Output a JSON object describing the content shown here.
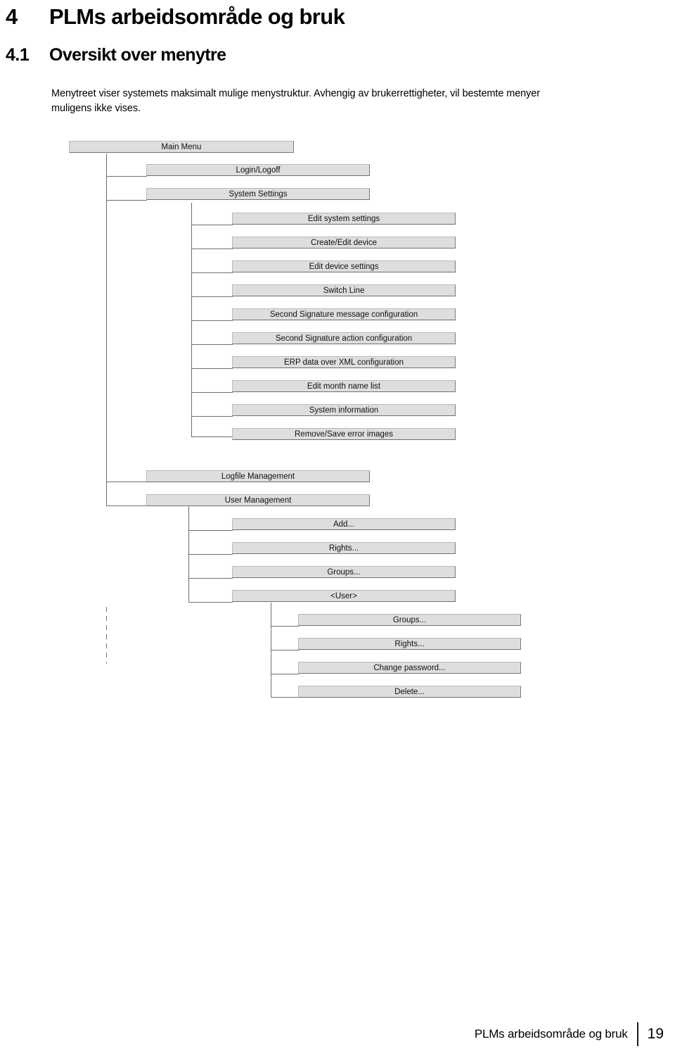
{
  "document": {
    "chapter_number": "4",
    "chapter_title": "PLMs arbeidsområde og bruk",
    "section_number": "4.1",
    "section_title": "Oversikt over menytre",
    "intro_paragraph": "Menytreet viser systemets maksimalt mulige menystruktur. Avhengig av brukerrettigheter, vil bestemte menyer muligens ikke vises."
  },
  "footer": {
    "title": "PLMs arbeidsområde og bruk",
    "page_number": "19"
  },
  "colors": {
    "node_fill": "#dedede",
    "node_border_dark": "#6f6f6f",
    "line": "#6f6f6f",
    "text": "#111111"
  },
  "menu_tree": {
    "root": "Main Menu",
    "nodes": [
      {
        "id": "main-menu",
        "label": "Main Menu",
        "level": 1
      },
      {
        "id": "login-logoff",
        "label": "Login/Logoff",
        "level": 2
      },
      {
        "id": "system-settings",
        "label": "System Settings",
        "level": 2
      },
      {
        "id": "edit-system-settings",
        "label": "Edit system settings",
        "level": 3
      },
      {
        "id": "create-edit-device",
        "label": "Create/Edit device",
        "level": 3
      },
      {
        "id": "edit-device-settings",
        "label": "Edit device settings",
        "level": 3
      },
      {
        "id": "switch-line",
        "label": "Switch Line",
        "level": 3
      },
      {
        "id": "second-signature-message-configuration",
        "label": "Second Signature message configuration",
        "level": 3
      },
      {
        "id": "second-signature-action-configuration",
        "label": "Second Signature action configuration",
        "level": 3
      },
      {
        "id": "erp-data-over-xml-configuration",
        "label": "ERP data over XML configuration",
        "level": 3
      },
      {
        "id": "edit-month-name-list",
        "label": "Edit month name list",
        "level": 3
      },
      {
        "id": "system-information",
        "label": "System information",
        "level": 3
      },
      {
        "id": "remove-save-error-images",
        "label": "Remove/Save error images",
        "level": 3
      },
      {
        "id": "logfile-management",
        "label": "Logfile Management",
        "level": 2
      },
      {
        "id": "user-management",
        "label": "User Management",
        "level": 2
      },
      {
        "id": "add",
        "label": "Add...",
        "level": 3
      },
      {
        "id": "rights",
        "label": "Rights...",
        "level": 3
      },
      {
        "id": "groups",
        "label": "Groups...",
        "level": 3
      },
      {
        "id": "user-placeholder",
        "label": "<User>",
        "level": 3
      },
      {
        "id": "user-groups",
        "label": "Groups...",
        "level": 4
      },
      {
        "id": "user-rights",
        "label": "Rights...",
        "level": 4
      },
      {
        "id": "user-change-password",
        "label": "Change password...",
        "level": 4
      },
      {
        "id": "user-delete",
        "label": "Delete...",
        "level": 4
      }
    ]
  }
}
